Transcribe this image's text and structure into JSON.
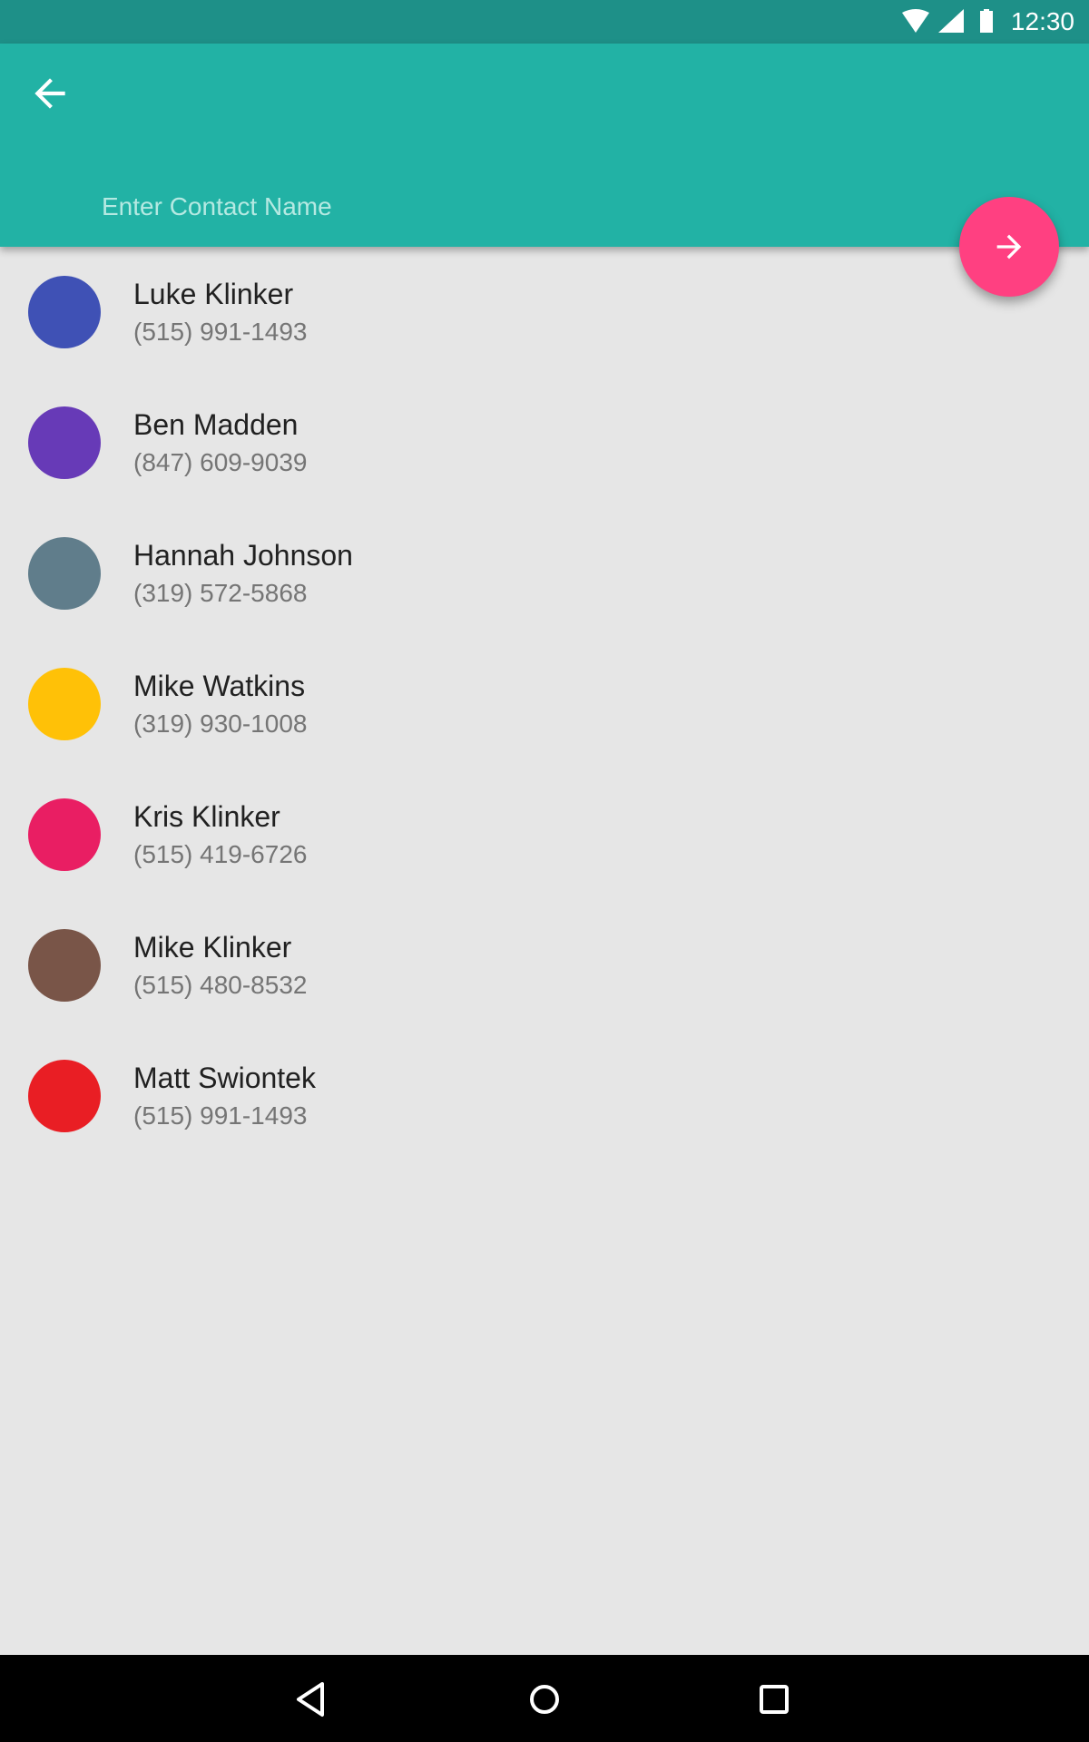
{
  "status_bar": {
    "time": "12:30",
    "icons": [
      "wifi-icon",
      "signal-icon",
      "battery-icon"
    ]
  },
  "toolbar": {
    "back_icon": "arrow-left-icon",
    "search_placeholder": "Enter Contact Name",
    "search_value": ""
  },
  "fab": {
    "icon": "arrow-right-icon",
    "color": "#ff4081"
  },
  "contacts": [
    {
      "name": "Luke Klinker",
      "phone": "(515) 991-1493",
      "color": "#3f51b5"
    },
    {
      "name": "Ben Madden",
      "phone": "(847) 609-9039",
      "color": "#673ab7"
    },
    {
      "name": "Hannah Johnson",
      "phone": "(319) 572-5868",
      "color": "#607d8b"
    },
    {
      "name": "Mike Watkins",
      "phone": "(319) 930-1008",
      "color": "#ffc107"
    },
    {
      "name": "Kris Klinker",
      "phone": "(515) 419-6726",
      "color": "#e91e63"
    },
    {
      "name": "Mike Klinker",
      "phone": "(515) 480-8532",
      "color": "#795548"
    },
    {
      "name": "Matt Swiontek",
      "phone": "(515) 991-1493",
      "color": "#e91e24"
    }
  ],
  "colors": {
    "primary": "#22b2a5",
    "primary_dark": "#1e9088",
    "accent": "#ff4081"
  }
}
